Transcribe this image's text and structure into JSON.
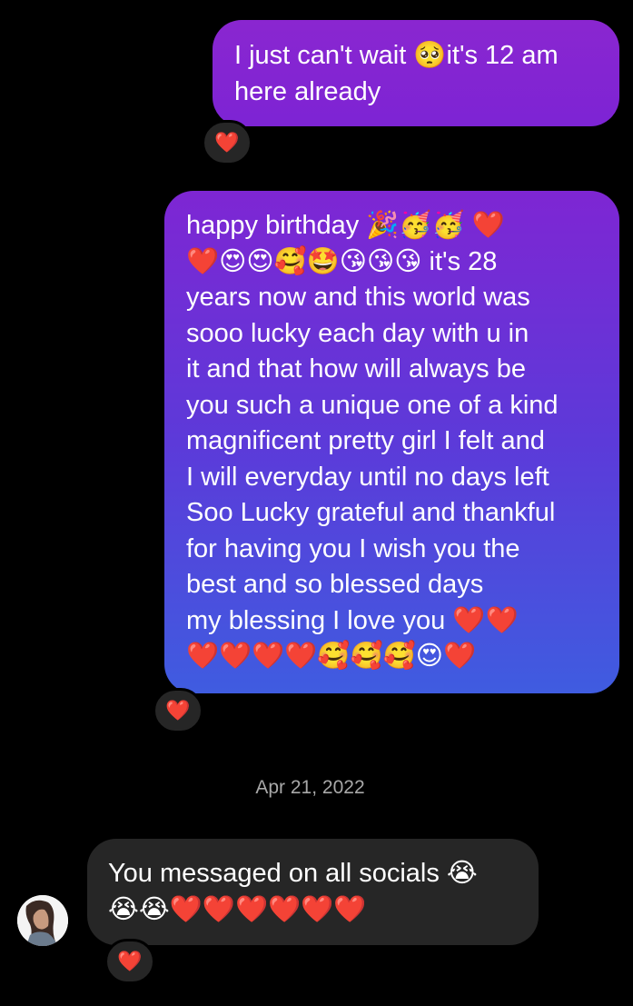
{
  "messages": [
    {
      "sender": "me",
      "text": "I just can't wait 🥺it's 12 am\nhere already",
      "reaction": "❤️"
    },
    {
      "sender": "me",
      "text": "happy birthday 🎉🥳🥳 ❤️\n❤️😍😍🥰🤩😘😘😘 it's 28\nyears now and this world was\nsooo lucky each day with u in\nit and that how will always be\nyou such a unique one of a kind\nmagnificent pretty girl I felt and\nI will everyday until no days left\nSoo Lucky grateful and thankful\nfor having you I wish you the\nbest and so blessed days\nmy blessing I love you ❤️❤️\n❤️❤️❤️❤️🥰🥰🥰😍❤️",
      "reaction": "❤️"
    },
    {
      "sender": "them",
      "text": "You messaged on all socials 😭\n😭😭❤️❤️❤️❤️❤️❤️",
      "reaction": "❤️"
    }
  ],
  "date_divider": "Apr 21, 2022",
  "colors": {
    "background": "#000000",
    "outgoing_top": "#8a26d0",
    "outgoing_bottom": "#3f5ce0",
    "incoming": "#262626",
    "reaction_bg": "#262626",
    "date_text": "#a8a8a8"
  }
}
